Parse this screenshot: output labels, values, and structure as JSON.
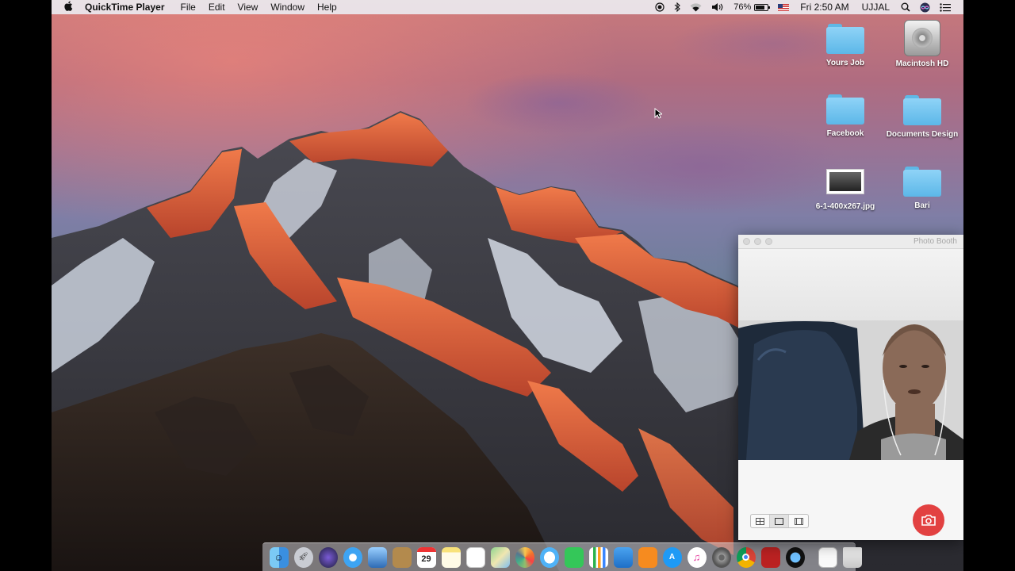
{
  "menubar": {
    "apple": "",
    "app_name": "QuickTime Player",
    "menus": [
      "File",
      "Edit",
      "View",
      "Window",
      "Help"
    ],
    "battery_percent": "76%",
    "battery_level": 0.76,
    "clock": "Fri 2:50 AM",
    "user": "UJJAL",
    "status_icons": [
      "record-icon",
      "bluetooth-icon",
      "wifi-icon",
      "volume-icon",
      "battery-icon",
      "us-flag-icon",
      "spotlight-icon",
      "siri-icon",
      "notification-center-icon"
    ]
  },
  "desktop": {
    "icons": [
      {
        "label": "Yours Job",
        "kind": "folder"
      },
      {
        "label": "Macintosh HD",
        "kind": "hard-drive"
      },
      {
        "label": "Facebook",
        "kind": "folder"
      },
      {
        "label": "Documents Design",
        "kind": "folder"
      },
      {
        "label": "6-1-400x267.jpg",
        "kind": "image-file"
      },
      {
        "label": "Bari",
        "kind": "folder"
      }
    ]
  },
  "photo_booth": {
    "title": "Photo Booth",
    "layout_buttons": [
      "four-up-icon",
      "single-photo-icon",
      "movie-clip-icon"
    ],
    "shutter": "camera-icon"
  },
  "dock": {
    "calendar_day": "29",
    "apps": [
      "finder-icon",
      "launchpad-icon",
      "siri-icon",
      "safari-icon",
      "preview-icon",
      "contacts-icon",
      "calendar-icon",
      "notes-icon",
      "reminders-icon",
      "maps-icon",
      "photos-icon",
      "messages-icon",
      "facetime-icon",
      "numbers-icon",
      "keynote-icon",
      "ibooks-icon",
      "app-store-icon",
      "itunes-icon",
      "system-preferences-icon",
      "chrome-icon",
      "photo-booth-icon",
      "quicktime-icon",
      "document-icon",
      "trash-icon"
    ]
  },
  "colors": {
    "folder_blue": "#6cc4f0",
    "shutter_red": "#e24141",
    "menubar_bg": "#eceaee"
  }
}
